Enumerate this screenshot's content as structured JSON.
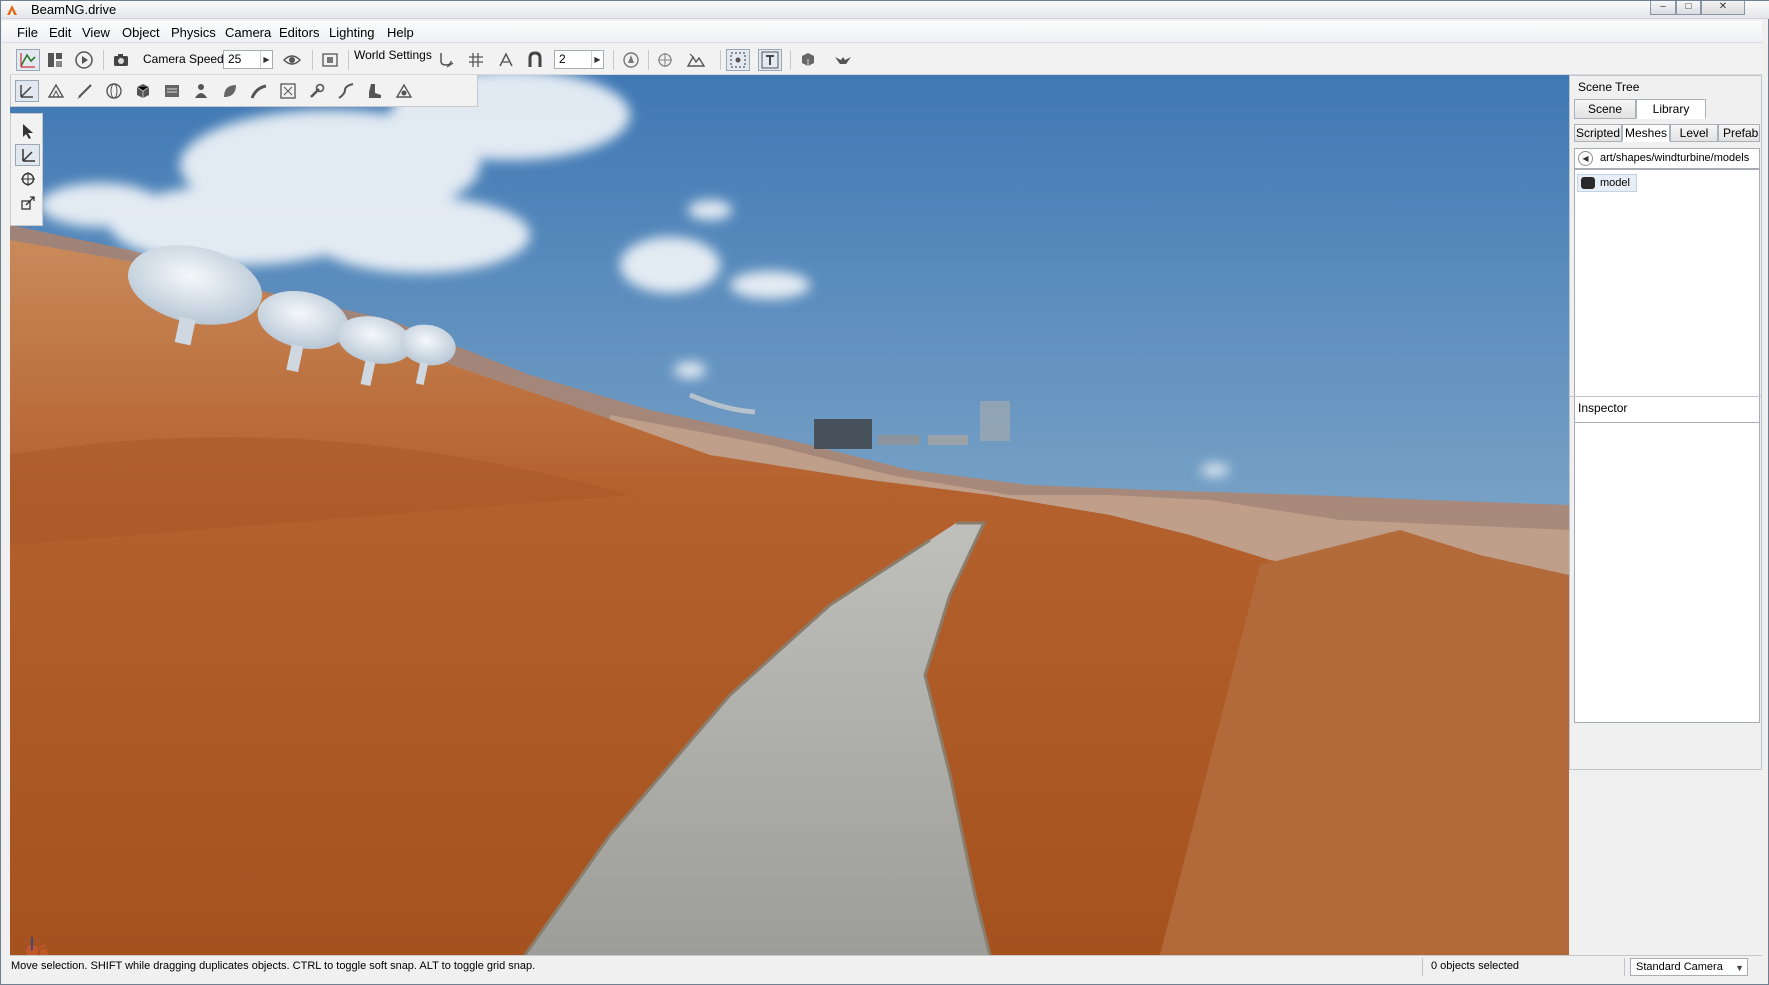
{
  "window": {
    "title": "BeamNG.drive",
    "minimize": "–",
    "maximize": "□",
    "close": "✕"
  },
  "menu": [
    "File",
    "Edit",
    "View",
    "Object",
    "Physics",
    "Camera",
    "Editors",
    "Lighting",
    "Help"
  ],
  "toolbar": {
    "camera_speed_label": "Camera Speed",
    "camera_speed_value": "25",
    "world_settings_label": "World Settings",
    "grid_size_value": "2"
  },
  "scene_tree": {
    "title": "Scene Tree",
    "tabs": [
      {
        "label": "Scene"
      },
      {
        "label": "Library",
        "active": true
      }
    ],
    "library_tabs": [
      {
        "label": "Scripted"
      },
      {
        "label": "Meshes",
        "active": true
      },
      {
        "label": "Level"
      },
      {
        "label": "Prefabs"
      }
    ],
    "path": "art/shapes/windturbine/models",
    "items": [
      {
        "label": "model",
        "icon": "mesh-icon"
      }
    ]
  },
  "inspector": {
    "title": "Inspector"
  },
  "statusbar": {
    "hint": "Move selection.  SHIFT while dragging duplicates objects.  CTRL to toggle soft snap.  ALT to toggle grid snap.",
    "selection": "0 objects selected",
    "camera_mode": "Standard Camera"
  },
  "colors": {
    "sky": "#4d7fb3",
    "terrain": "#b0602e",
    "road": "#a9a9a6",
    "selection_blue": "#cfe0f2"
  }
}
